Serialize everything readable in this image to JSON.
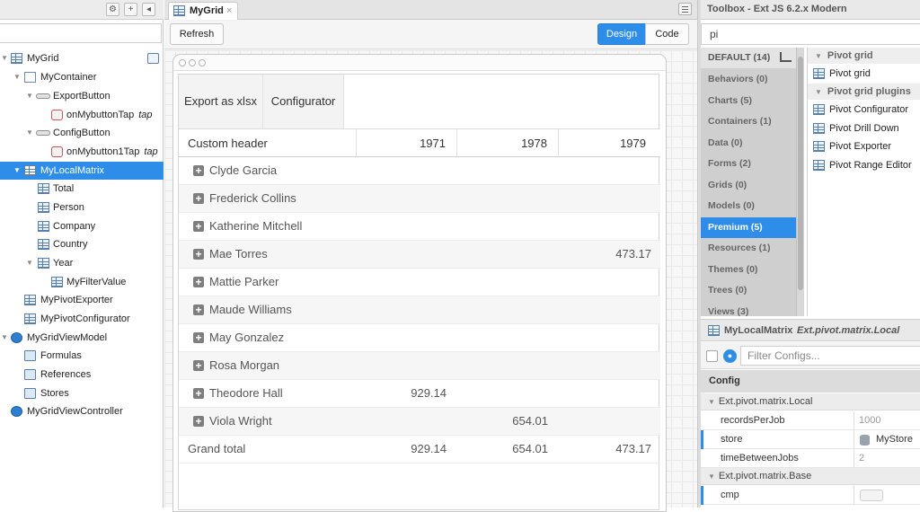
{
  "left_panel": {
    "tree": [
      {
        "label": "MyGrid"
      },
      {
        "label": "MyContainer"
      },
      {
        "label": "ExportButton"
      },
      {
        "label": "onMybuttonTap",
        "event": "tap"
      },
      {
        "label": "ConfigButton"
      },
      {
        "label": "onMybutton1Tap",
        "event": "tap"
      },
      {
        "label": "MyLocalMatrix"
      },
      {
        "label": "Total"
      },
      {
        "label": "Person"
      },
      {
        "label": "Company"
      },
      {
        "label": "Country"
      },
      {
        "label": "Year"
      },
      {
        "label": "MyFilterValue"
      },
      {
        "label": "MyPivotExporter"
      },
      {
        "label": "MyPivotConfigurator"
      },
      {
        "label": "MyGridViewModel"
      },
      {
        "label": "Formulas"
      },
      {
        "label": "References"
      },
      {
        "label": "Stores"
      },
      {
        "label": "MyGridViewController"
      }
    ]
  },
  "editor": {
    "tab_label": "MyGrid",
    "refresh_label": "Refresh",
    "design_label": "Design",
    "code_label": "Code"
  },
  "grid": {
    "export_label": "Export as xlsx",
    "configurator_label": "Configurator",
    "columns": [
      "Custom header",
      "1971",
      "1978",
      "1979"
    ],
    "rows": [
      {
        "name": "Clyde Garcia",
        "v1971": "",
        "v1978": "",
        "v1979": ""
      },
      {
        "name": "Frederick Collins",
        "v1971": "",
        "v1978": "",
        "v1979": ""
      },
      {
        "name": "Katherine Mitchell",
        "v1971": "",
        "v1978": "",
        "v1979": ""
      },
      {
        "name": "Mae Torres",
        "v1971": "",
        "v1978": "",
        "v1979": "473.17"
      },
      {
        "name": "Mattie Parker",
        "v1971": "",
        "v1978": "",
        "v1979": ""
      },
      {
        "name": "Maude Williams",
        "v1971": "",
        "v1978": "",
        "v1979": ""
      },
      {
        "name": "May Gonzalez",
        "v1971": "",
        "v1978": "",
        "v1979": ""
      },
      {
        "name": "Rosa Morgan",
        "v1971": "",
        "v1978": "",
        "v1979": ""
      },
      {
        "name": "Theodore Hall",
        "v1971": "929.14",
        "v1978": "",
        "v1979": ""
      },
      {
        "name": "Viola Wright",
        "v1971": "",
        "v1978": "654.01",
        "v1979": ""
      }
    ],
    "grand_total": {
      "name": "Grand total",
      "v1971": "929.14",
      "v1978": "654.01",
      "v1979": "473.17"
    }
  },
  "toolbox": {
    "title": "Toolbox - Ext JS 6.2.x Modern",
    "search_value": "pi",
    "categories": [
      "DEFAULT (14)",
      "Behaviors (0)",
      "Charts (5)",
      "Containers (1)",
      "Data (0)",
      "Forms (2)",
      "Grids (0)",
      "Models (0)",
      "Premium (5)",
      "Resources (1)",
      "Themes (0)",
      "Trees (0)",
      "Views (3)"
    ],
    "group1": "Pivot grid",
    "group1_items": [
      "Pivot grid"
    ],
    "group2": "Pivot grid plugins",
    "group2_items": [
      "Pivot Configurator",
      "Pivot Drill Down",
      "Pivot Exporter",
      "Pivot Range Editor"
    ]
  },
  "config": {
    "component": "MyLocalMatrix",
    "class": "Ext.pivot.matrix.Local",
    "filter_placeholder": "Filter Configs...",
    "header": "Config",
    "group_local": "Ext.pivot.matrix.Local",
    "rows_local": [
      {
        "key": "recordsPerJob",
        "value": "1000"
      },
      {
        "key": "store",
        "value": "MyStore"
      },
      {
        "key": "timeBetweenJobs",
        "value": "2"
      }
    ],
    "group_base": "Ext.pivot.matrix.Base",
    "rows_base": [
      {
        "key": "cmp",
        "value": ""
      }
    ]
  }
}
